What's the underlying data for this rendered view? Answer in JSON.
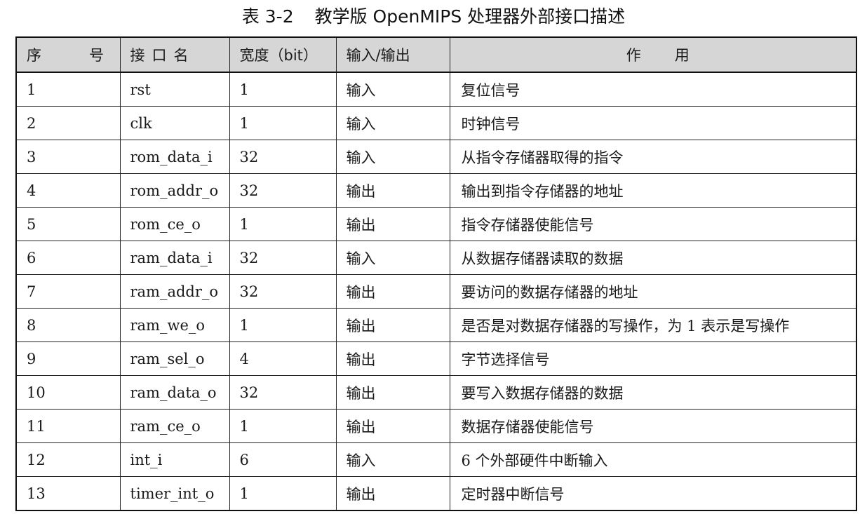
{
  "caption": {
    "number": "表 3-2",
    "title": "教学版 OpenMIPS 处理器外部接口描述"
  },
  "table": {
    "headers": {
      "index_a": "序",
      "index_b": "号",
      "name": "接口名",
      "width": "宽度（bit）",
      "direction": "输入/输出",
      "use_a": "作",
      "use_b": "用"
    },
    "rows": [
      {
        "no": "1",
        "name": "rst",
        "width": "1",
        "dir": "输入",
        "desc": "复位信号"
      },
      {
        "no": "2",
        "name": "clk",
        "width": "1",
        "dir": "输入",
        "desc": "时钟信号"
      },
      {
        "no": "3",
        "name": "rom_data_i",
        "width": "32",
        "dir": "输入",
        "desc": "从指令存储器取得的指令"
      },
      {
        "no": "4",
        "name": "rom_addr_o",
        "width": "32",
        "dir": "输出",
        "desc": "输出到指令存储器的地址"
      },
      {
        "no": "5",
        "name": "rom_ce_o",
        "width": "1",
        "dir": "输出",
        "desc": "指令存储器使能信号"
      },
      {
        "no": "6",
        "name": "ram_data_i",
        "width": "32",
        "dir": "输入",
        "desc": "从数据存储器读取的数据"
      },
      {
        "no": "7",
        "name": "ram_addr_o",
        "width": "32",
        "dir": "输出",
        "desc": "要访问的数据存储器的地址"
      },
      {
        "no": "8",
        "name": "ram_we_o",
        "width": "1",
        "dir": "输出",
        "desc": "是否是对数据存储器的写操作，为 1 表示是写操作"
      },
      {
        "no": "9",
        "name": "ram_sel_o",
        "width": "4",
        "dir": "输出",
        "desc": "字节选择信号"
      },
      {
        "no": "10",
        "name": "ram_data_o",
        "width": "32",
        "dir": "输出",
        "desc": "要写入数据存储器的数据"
      },
      {
        "no": "11",
        "name": "ram_ce_o",
        "width": "1",
        "dir": "输出",
        "desc": "数据存储器使能信号"
      },
      {
        "no": "12",
        "name": "int_i",
        "width": "6",
        "dir": "输入",
        "desc": "6 个外部硬件中断输入"
      },
      {
        "no": "13",
        "name": "timer_int_o",
        "width": "1",
        "dir": "输出",
        "desc": "定时器中断信号"
      }
    ]
  }
}
